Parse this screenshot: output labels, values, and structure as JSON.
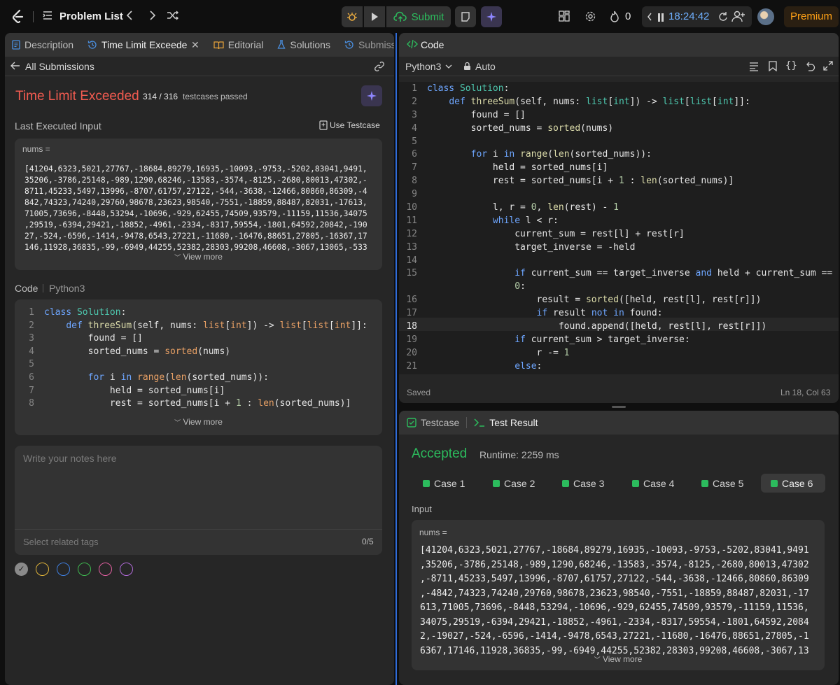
{
  "topbar": {
    "problem_list": "Problem List",
    "submit": "Submit",
    "streak": "0",
    "timer": "18:24:42",
    "premium": "Premium"
  },
  "left": {
    "tabs": [
      "Description",
      "Time Limit Exceede",
      "Editorial",
      "Solutions",
      "Submissi"
    ],
    "back": "All Submissions",
    "status": "Time Limit Exceeded",
    "passed": "314 / 316",
    "passed_suffix": "testcases passed",
    "last_input_label": "Last Executed Input",
    "use_testcase": "Use Testcase",
    "nums_label": "nums =",
    "input_lines": [
      "[41204,6323,5021,27767,-18684,89279,16935,-10093,-9753,-5202,83041,9491,",
      "35206,-3786,25148,-989,1290,68246,-13583,-3574,-8125,-2680,80013,47302,-",
      "8711,45233,5497,13996,-8707,61757,27122,-544,-3638,-12466,80860,86309,-4",
      "842,74323,74240,29760,98678,23623,98540,-7551,-18859,88487,82031,-17613,",
      "71005,73696,-8448,53294,-10696,-929,62455,74509,93579,-11159,11536,34075",
      ",29519,-6394,29421,-18852,-4961,-2334,-8317,59554,-1801,64592,20842,-190",
      "27,-524,-6596,-1414,-9478,6543,27221,-11680,-16476,88651,27805,-16367,17",
      "146,11928,36835,-99,-6949,44255,52382,28303,99208,46608,-3067,13065,-533"
    ],
    "view_more": "View more",
    "code_label": "Code",
    "code_lang": "Python3",
    "notes_placeholder": "Write your notes here",
    "tags_placeholder": "Select related tags",
    "tags_count": "0/5",
    "circle_colors": [
      "#8a8a8a",
      "#e0b43a",
      "#3f7fe0",
      "#3fb950",
      "#e05fa0",
      "#b06ad8"
    ]
  },
  "editor": {
    "title": "Code",
    "lang": "Python3",
    "auto": "Auto",
    "saved": "Saved",
    "position": "Ln 18, Col 63"
  },
  "result": {
    "testcase_tab": "Testcase",
    "result_tab": "Test Result",
    "status": "Accepted",
    "runtime": "Runtime: 2259 ms",
    "cases": [
      "Case 1",
      "Case 2",
      "Case 3",
      "Case 4",
      "Case 5",
      "Case 6"
    ],
    "input_label": "Input",
    "nums_label": "nums =",
    "input_lines": [
      "[41204,6323,5021,27767,-18684,89279,16935,-10093,-9753,-5202,83041,9491",
      ",35206,-3786,25148,-989,1290,68246,-13583,-3574,-8125,-2680,80013,47302",
      ",-8711,45233,5497,13996,-8707,61757,27122,-544,-3638,-12466,80860,86309",
      ",-4842,74323,74240,29760,98678,23623,98540,-7551,-18859,88487,82031,-17",
      "613,71005,73696,-8448,53294,-10696,-929,62455,74509,93579,-11159,11536,",
      "34075,29519,-6394,29421,-18852,-4961,-2334,-8317,59554,-1801,64592,2084",
      "2,-19027,-524,-6596,-1414,-9478,6543,27221,-11680,-16476,88651,27805,-1",
      "6367,17146,11928,36835,-99,-6949,44255,52382,28303,99208,46608,-3067,13"
    ],
    "view_more": "View more"
  }
}
